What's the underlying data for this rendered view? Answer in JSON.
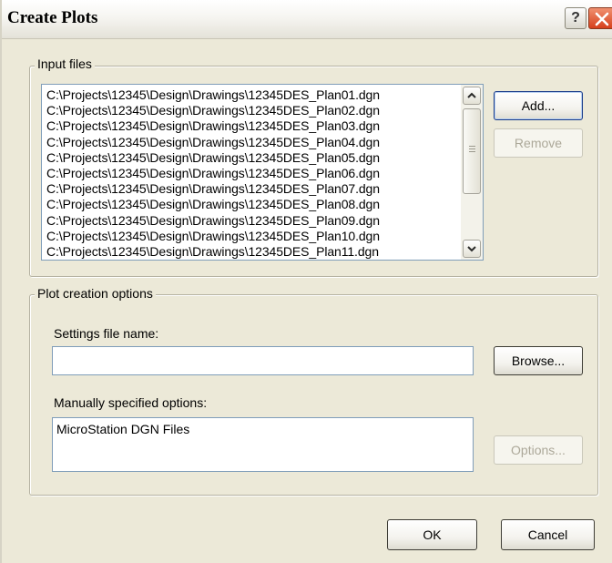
{
  "window": {
    "title": "Create Plots",
    "help_label": "?"
  },
  "input_files": {
    "group_label": "Input files",
    "files": [
      "C:\\Projects\\12345\\Design\\Drawings\\12345DES_Plan01.dgn",
      "C:\\Projects\\12345\\Design\\Drawings\\12345DES_Plan02.dgn",
      "C:\\Projects\\12345\\Design\\Drawings\\12345DES_Plan03.dgn",
      "C:\\Projects\\12345\\Design\\Drawings\\12345DES_Plan04.dgn",
      "C:\\Projects\\12345\\Design\\Drawings\\12345DES_Plan05.dgn",
      "C:\\Projects\\12345\\Design\\Drawings\\12345DES_Plan06.dgn",
      "C:\\Projects\\12345\\Design\\Drawings\\12345DES_Plan07.dgn",
      "C:\\Projects\\12345\\Design\\Drawings\\12345DES_Plan08.dgn",
      "C:\\Projects\\12345\\Design\\Drawings\\12345DES_Plan09.dgn",
      "C:\\Projects\\12345\\Design\\Drawings\\12345DES_Plan10.dgn",
      "C:\\Projects\\12345\\Design\\Drawings\\12345DES_Plan11.dgn"
    ],
    "add_label": "Add...",
    "remove_label": "Remove"
  },
  "plot_options": {
    "group_label": "Plot creation options",
    "settings_label": "Settings file name:",
    "settings_value": "",
    "browse_label": "Browse...",
    "manual_label": "Manually specified options:",
    "manual_value": "MicroStation DGN Files",
    "options_label": "Options..."
  },
  "footer": {
    "ok_label": "OK",
    "cancel_label": "Cancel"
  }
}
